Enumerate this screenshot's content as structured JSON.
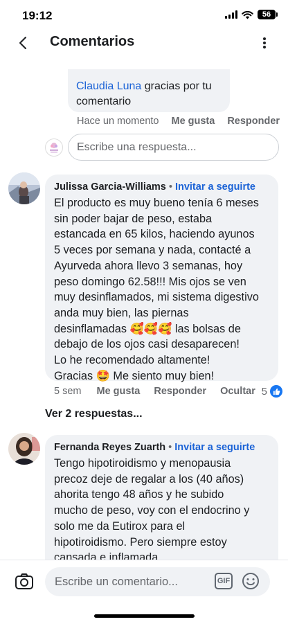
{
  "status": {
    "time": "19:12",
    "battery": "56"
  },
  "header": {
    "title": "Comentarios"
  },
  "top_reply": {
    "mention": "Claudia Luna",
    "line1_rest": " gracias por tu",
    "line2": "comentario",
    "time": "Hace un momento",
    "like": "Me gusta",
    "reply": "Responder"
  },
  "reply_input": {
    "placeholder": "Escribe una respuesta..."
  },
  "comments": [
    {
      "name": "Julissa Garcia-Williams",
      "dot": "•",
      "follow": "Invitar a seguirte",
      "text": "El producto es muy bueno tenía 6 meses\nsin poder bajar de peso, estaba\nestancada en 65 kilos, haciendo ayunos\n5 veces por semana y nada, contacté a\nAyurveda ahora llevo 3 semanas, hoy\npeso domingo 62.58!!! Mis ojos se ven\nmuy desinflamados, mi sistema digestivo\nanda muy bien, las piernas\ndesinflamadas 🥰🥰🥰 las bolsas de\ndebajo de los ojos casi desaparecen!\nLo he recomendado altamente!\nGracias 🤩 Me siento muy bien!",
      "time": "5 sem",
      "like": "Me gusta",
      "reply": "Responder",
      "hide": "Ocultar",
      "reaction_count": "5",
      "view_replies": "Ver 2 respuestas..."
    },
    {
      "name": "Fernanda Reyes Zuarth",
      "dot": "•",
      "follow": "Invitar a seguirte",
      "text": "Tengo hipotiroidismo y menopausia\nprecoz deje de regalar a los (40 años)\nahorita tengo 48 años y he subido\nmucho de peso, voy con el endocrino y\nsolo me da Eutirox para el\nhipotiroidismo. Pero siempre estoy\ncansada e inflamada."
    }
  ],
  "composer": {
    "placeholder": "Escribe un comentario...",
    "gif_label": "GIF"
  },
  "icons": {
    "back": "chevron-left-icon",
    "more": "more-vertical-icon",
    "camera": "camera-icon",
    "gif": "gif-icon",
    "emoji": "smiley-icon",
    "like": "thumbs-up-icon"
  },
  "colors": {
    "link": "#1a62d6",
    "bubble": "#f0f2f5",
    "muted": "#65676b",
    "like_badge": "#1877f2"
  }
}
